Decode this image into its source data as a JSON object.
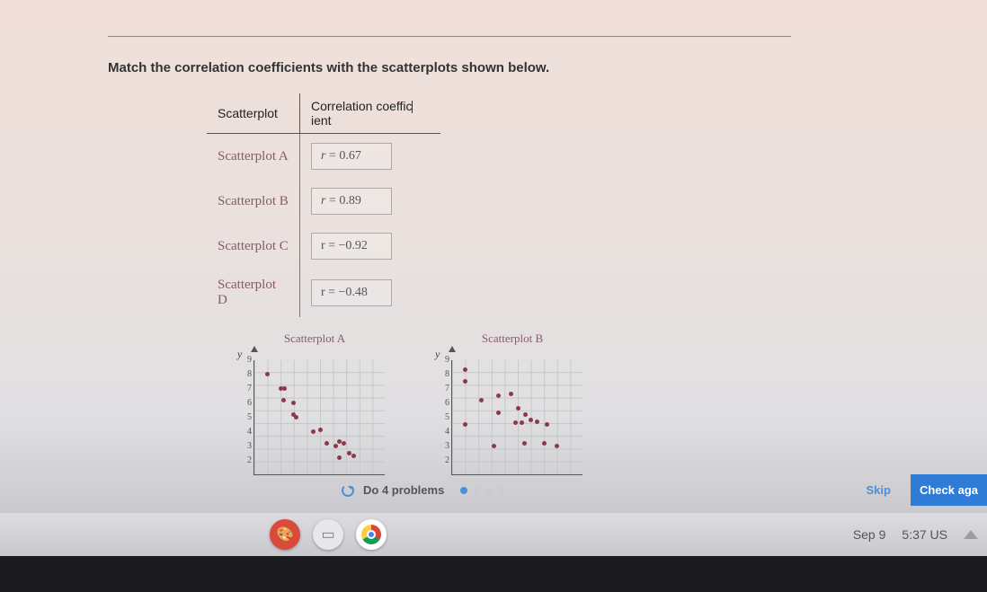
{
  "prompt": "Match the correlation coefficients with the scatterplots shown below.",
  "table": {
    "headers": {
      "col1": "Scatterplot",
      "col2": "Correlation coeffic",
      "col2_after": "ient"
    },
    "rows": [
      {
        "label": "Scatterplot A",
        "r_text": "r = 0.67",
        "r": 0.67
      },
      {
        "label": "Scatterplot B",
        "r_text": "r = 0.89",
        "r": 0.89
      },
      {
        "label": "Scatterplot C",
        "r_text": "r = −0.92",
        "r": -0.92
      },
      {
        "label": "Scatterplot D",
        "r_text": "r = −0.48",
        "r": -0.48
      }
    ]
  },
  "chart_data": [
    {
      "type": "scatter",
      "title": "Scatterplot A",
      "xlabel": "",
      "ylabel": "y",
      "xlim": [
        0,
        10
      ],
      "ylim": [
        1,
        9
      ],
      "y_ticks": [
        2,
        3,
        4,
        5,
        6,
        7,
        8,
        9
      ],
      "points": [
        {
          "x": 1,
          "y": 8
        },
        {
          "x": 2,
          "y": 7
        },
        {
          "x": 2.3,
          "y": 7
        },
        {
          "x": 2.2,
          "y": 6.2
        },
        {
          "x": 3,
          "y": 6
        },
        {
          "x": 3,
          "y": 5.2
        },
        {
          "x": 3.2,
          "y": 5
        },
        {
          "x": 4.5,
          "y": 4
        },
        {
          "x": 5,
          "y": 4.1
        },
        {
          "x": 5.5,
          "y": 3.2
        },
        {
          "x": 6.2,
          "y": 3
        },
        {
          "x": 6.5,
          "y": 3.3
        },
        {
          "x": 6.8,
          "y": 3.2
        },
        {
          "x": 7.2,
          "y": 2.5
        },
        {
          "x": 7.6,
          "y": 2.3
        },
        {
          "x": 6.5,
          "y": 2.2
        }
      ]
    },
    {
      "type": "scatter",
      "title": "Scatterplot B",
      "xlabel": "",
      "ylabel": "y",
      "xlim": [
        0,
        10
      ],
      "ylim": [
        1,
        9
      ],
      "y_ticks": [
        2,
        3,
        4,
        5,
        6,
        7,
        8,
        9
      ],
      "points": [
        {
          "x": 1,
          "y": 8.3
        },
        {
          "x": 1,
          "y": 7.5
        },
        {
          "x": 2.2,
          "y": 6.2
        },
        {
          "x": 3.5,
          "y": 6.5
        },
        {
          "x": 4.5,
          "y": 6.6
        },
        {
          "x": 3.5,
          "y": 5.3
        },
        {
          "x": 5,
          "y": 5.6
        },
        {
          "x": 5.6,
          "y": 5.2
        },
        {
          "x": 1,
          "y": 4.5
        },
        {
          "x": 4.8,
          "y": 4.6
        },
        {
          "x": 5.3,
          "y": 4.6
        },
        {
          "x": 6,
          "y": 4.8
        },
        {
          "x": 6.5,
          "y": 4.7
        },
        {
          "x": 7.2,
          "y": 4.5
        },
        {
          "x": 3.2,
          "y": 3
        },
        {
          "x": 5.5,
          "y": 3.2
        },
        {
          "x": 7,
          "y": 3.2
        },
        {
          "x": 8,
          "y": 3
        }
      ]
    }
  ],
  "footer": {
    "do_label": "Do 4 problems",
    "progress": {
      "total": 4,
      "current": 1
    },
    "skip": "Skip",
    "check": "Check aga"
  },
  "taskbar": {
    "icons": [
      "palette-icon",
      "reader-icon",
      "chrome-icon"
    ],
    "date": "Sep 9",
    "time": "5:37",
    "locale": "US"
  }
}
